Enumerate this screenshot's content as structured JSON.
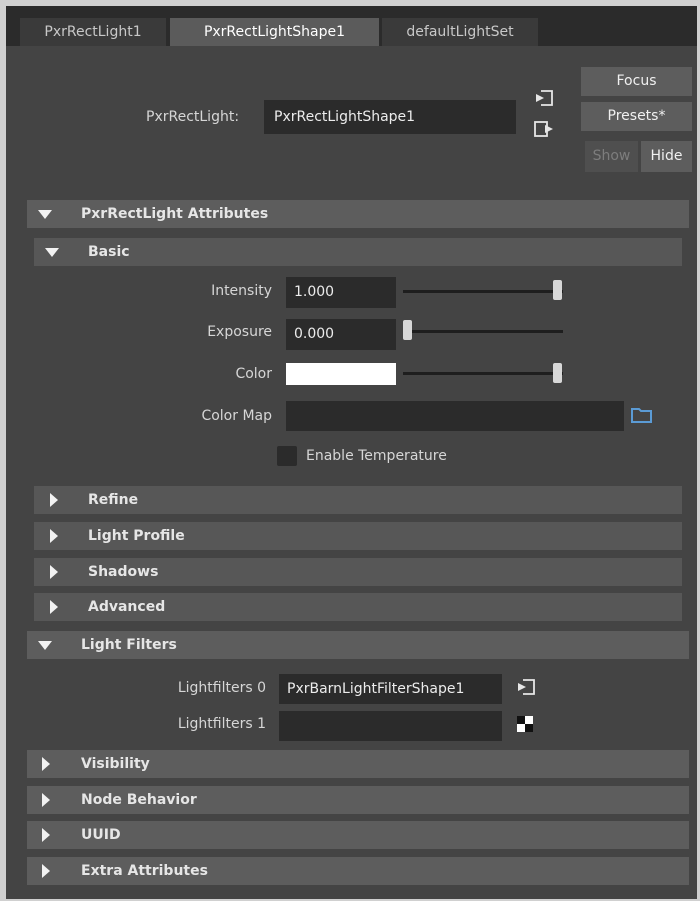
{
  "tabs": [
    {
      "label": "PxrRectLight1"
    },
    {
      "label": "PxrRectLightShape1"
    },
    {
      "label": "defaultLightSet"
    }
  ],
  "header": {
    "node_label": "PxrRectLight:",
    "node_value": "PxrRectLightShape1",
    "focus_label": "Focus",
    "presets_label": "Presets*",
    "show_label": "Show",
    "hide_label": "Hide"
  },
  "sections": {
    "attributes": "PxrRectLight Attributes",
    "basic": "Basic",
    "refine": "Refine",
    "light_profile": "Light Profile",
    "shadows": "Shadows",
    "advanced": "Advanced",
    "light_filters": "Light Filters",
    "visibility": "Visibility",
    "node_behavior": "Node Behavior",
    "uuid": "UUID",
    "extra_attributes": "Extra Attributes"
  },
  "basic": {
    "intensity_label": "Intensity",
    "intensity_value": "1.000",
    "intensity_slider_fraction": 1.0,
    "exposure_label": "Exposure",
    "exposure_value": "0.000",
    "exposure_slider_fraction": 0.0,
    "color_label": "Color",
    "color_swatch": "#ffffff",
    "color_slider_fraction": 1.0,
    "color_map_label": "Color Map",
    "color_map_value": "",
    "enable_temperature_label": "Enable Temperature",
    "enable_temperature_checked": false
  },
  "light_filters": {
    "filter0_label": "Lightfilters 0",
    "filter0_value": "PxrBarnLightFilterShape1",
    "filter1_label": "Lightfilters 1",
    "filter1_value": ""
  },
  "icons": {
    "input_connection": "input-connection-icon",
    "output_connection": "output-connection-icon",
    "folder": "folder-icon",
    "checker": "checker-map-icon"
  },
  "colors": {
    "panel": "#444444",
    "header": "#5d5d5d",
    "field": "#2b2b2b",
    "folder_icon": "#5b9bd5"
  }
}
